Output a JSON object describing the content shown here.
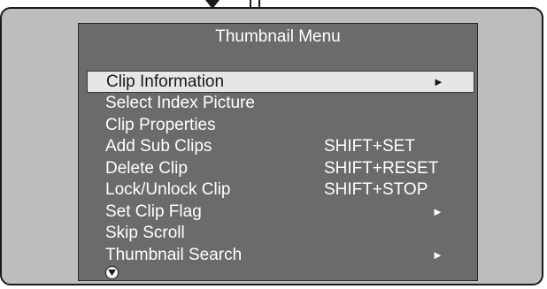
{
  "menu": {
    "title": "Thumbnail Menu",
    "items": [
      {
        "label": "Clip Information",
        "shortcut": "",
        "arrow": "►",
        "selected": true
      },
      {
        "label": "Select Index Picture",
        "shortcut": "",
        "arrow": "",
        "selected": false
      },
      {
        "label": "Clip Properties",
        "shortcut": "",
        "arrow": "",
        "selected": false
      },
      {
        "label": "Add Sub Clips",
        "shortcut": "SHIFT+SET",
        "arrow": "",
        "selected": false
      },
      {
        "label": "Delete Clip",
        "shortcut": "SHIFT+RESET",
        "arrow": "",
        "selected": false
      },
      {
        "label": "Lock/Unlock Clip",
        "shortcut": "SHIFT+STOP",
        "arrow": "",
        "selected": false
      },
      {
        "label": "Set Clip Flag",
        "shortcut": "",
        "arrow": "►",
        "selected": false
      },
      {
        "label": "Skip Scroll",
        "shortcut": "",
        "arrow": "",
        "selected": false
      },
      {
        "label": "Thumbnail Search",
        "shortcut": "",
        "arrow": "►",
        "selected": false
      }
    ],
    "scroll_icon": "scroll-down-icon"
  },
  "colors": {
    "frame_background": "#bdbdbd",
    "panel_background": "#6b6b6b",
    "text": "#ffffff",
    "selected_background": "#e6e6e6",
    "selected_text": "#1a1a1a"
  }
}
